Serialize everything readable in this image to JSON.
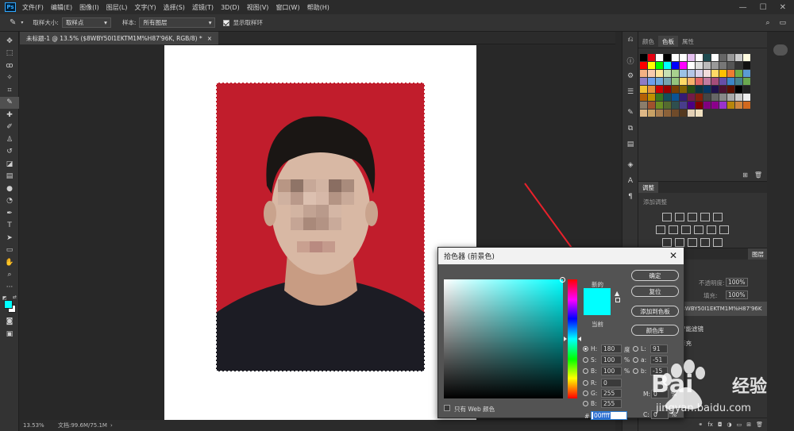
{
  "menu": {
    "app_icon": "Ps",
    "items": [
      "文件(F)",
      "编辑(E)",
      "图像(I)",
      "图层(L)",
      "文字(Y)",
      "选择(S)",
      "滤镜(T)",
      "3D(D)",
      "视图(V)",
      "窗口(W)",
      "帮助(H)"
    ],
    "window_controls": [
      "—",
      "☐",
      "✕"
    ]
  },
  "options": {
    "sample_size_label": "取样大小:",
    "sample_size_value": "取样点",
    "sample_label": "样本:",
    "sample_value": "所有图层",
    "show_ring_label": "显示取样环"
  },
  "document": {
    "tab_title": "未标题-1 @ 13.5% ($8WBY50I1EKTM1M%H87'96K, RGB/8) *",
    "tab_close": "×"
  },
  "status": {
    "zoom": "13.53%",
    "doc_size": "文档:99.6M/75.1M"
  },
  "right_panel": {
    "tabs": [
      "颜色",
      "色板",
      "属性"
    ],
    "active_tab": "色板",
    "adjust_title": "调整",
    "adjust_subtitle": "添加调整",
    "layers_tab": "图层",
    "opacity_label": "不透明度:",
    "opacity_value": "100%",
    "fill_label": "填充:",
    "fill_value": "100%",
    "layer_name": "$8WBY50I1EKTM1M%H87'96K",
    "smart_filter": "智能滤镜",
    "effect_name": "库充"
  },
  "picker": {
    "title": "拾色器 (前景色)",
    "new_label": "新的",
    "current_label": "当前",
    "ok": "确定",
    "reset": "复位",
    "add_swatch": "添加到色板",
    "color_libraries": "颜色库",
    "web_only": "只有 Web 颜色",
    "H": {
      "label": "H:",
      "value": "180",
      "unit": "度"
    },
    "S": {
      "label": "S:",
      "value": "100",
      "unit": "%"
    },
    "B": {
      "label": "B:",
      "value": "100",
      "unit": "%"
    },
    "R": {
      "label": "R:",
      "value": "0"
    },
    "G": {
      "label": "G:",
      "value": "255"
    },
    "Bl": {
      "label": "B:",
      "value": "255"
    },
    "L": {
      "label": "L:",
      "value": "91"
    },
    "a": {
      "label": "a:",
      "value": "-51"
    },
    "b": {
      "label": "b:",
      "value": "-15"
    },
    "C": {
      "label": "C:",
      "value": "0",
      "unit": "%"
    },
    "M": {
      "label": "M:",
      "value": "0",
      "unit": "%"
    },
    "hex_label": "#",
    "hex": "00ffff",
    "new_color": "#00ffff",
    "current_color": "#00ffff"
  },
  "watermark": {
    "brand": "Bai",
    "brand_cn": "经验",
    "url": "jingyan.baidu.com"
  }
}
